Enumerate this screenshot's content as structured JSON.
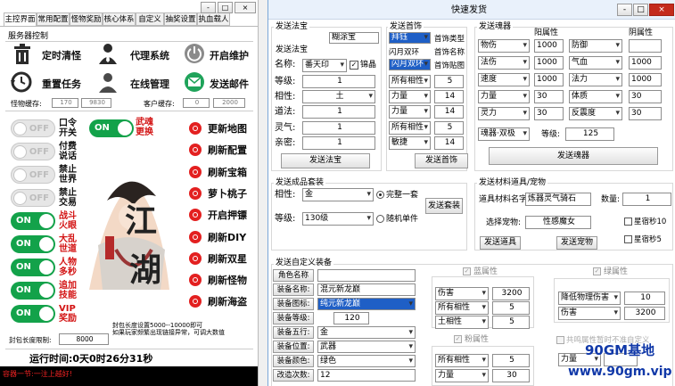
{
  "left": {
    "title": "",
    "tabs": [
      "主控界面",
      "常用配置",
      "怪物奖励",
      "核心体系",
      "自定义",
      "抽奖设置",
      "执血载人"
    ],
    "server_section": "服务器控制",
    "server_buttons": [
      {
        "label": "定时清怪",
        "icon": "trash-icon"
      },
      {
        "label": "代理系统",
        "icon": "agent-icon"
      },
      {
        "label": "开启维护",
        "icon": "power-icon"
      },
      {
        "label": "重置任务",
        "icon": "refresh-clock-icon"
      },
      {
        "label": "在线管理",
        "icon": "users-icon"
      },
      {
        "label": "发送邮件",
        "icon": "mail-icon"
      }
    ],
    "monster_cache_label": "怪物缓存:",
    "monster_cache_a": "170",
    "monster_cache_b": "9830",
    "client_cache_label": "客户缓存:",
    "client_cache_a": "0",
    "client_cache_b": "2000",
    "toggles": [
      {
        "state": "OFF",
        "label": "口令开关",
        "red": false
      },
      {
        "state": "OFF",
        "label": "付费说话",
        "red": false
      },
      {
        "state": "OFF",
        "label": "禁止世界",
        "red": false
      },
      {
        "state": "OFF",
        "label": "禁止交易",
        "red": false
      },
      {
        "state": "ON",
        "label": "战斗火眼",
        "red": true
      },
      {
        "state": "ON",
        "label": "大乱世道",
        "red": true
      },
      {
        "state": "ON",
        "label": "人物多秒",
        "red": true
      },
      {
        "state": "ON",
        "label": "追加技能",
        "red": true
      },
      {
        "state": "ON",
        "label": "VIP奖励",
        "red": true
      }
    ],
    "toggle_top": {
      "state": "ON",
      "label": "武魂更换"
    },
    "right_links": [
      "更新地图",
      "刷新配置",
      "刷新宝箱",
      "萝卜桃子",
      "开启押镖",
      "刷新DIY",
      "刷新双星",
      "刷新怪物",
      "刷新海盗"
    ],
    "note1": "封包长度设置5000--10000即可",
    "note2": "如果玩家频繁出现链接异常，可调大数值",
    "packet_label": "封包长度限制:",
    "packet_value": "8000",
    "runtime": "运行时间:0天0时26分31秒",
    "status_red": "容器一节:一注上越好!"
  },
  "right": {
    "title": "快速发货",
    "win_buttons": [
      "-",
      "□",
      "×"
    ],
    "left_win_buttons": [
      "-",
      "□",
      "×"
    ],
    "fabao": {
      "group": "发送法宝",
      "name_label": "名称:",
      "name_value": "番天印",
      "checkbox_label": "锦晶",
      "checkbox_checked": true,
      "rows": [
        {
          "label": "等级:",
          "value": "1"
        },
        {
          "label": "相性:",
          "value": "土"
        },
        {
          "label": "道法:",
          "value": "1"
        },
        {
          "label": "灵气:",
          "value": "1"
        },
        {
          "label": "亲密:",
          "value": "1"
        }
      ],
      "top_label": "发送法宝",
      "top_value": "糊涂宝",
      "button": "发送法宝"
    },
    "shoushi": {
      "group": "发送首饰",
      "top_value": "拜钰",
      "type_label": "首饰类型",
      "alias_label": "首饰名称",
      "name_value": "闪月双环",
      "sticker_label": "首饰贴图",
      "rows": [
        {
          "a": "所有相性",
          "b": "5"
        },
        {
          "a": "力量",
          "b": "14"
        },
        {
          "a": "力量",
          "b": "14"
        },
        {
          "a": "所有相性",
          "b": "5"
        },
        {
          "a": "敏捷",
          "b": "14"
        }
      ],
      "button": "发送首饰"
    },
    "soul": {
      "group": "发送魂器",
      "col1": "阳属性",
      "col2": "阴属性",
      "rows": [
        {
          "a": "物伤",
          "av": "1000",
          "b": "防御",
          "bv": ""
        },
        {
          "a": "法伤",
          "av": "1000",
          "b": "气血",
          "bv": "1000"
        },
        {
          "a": "速度",
          "av": "1000",
          "b": "法力",
          "bv": "1000"
        },
        {
          "a": "力量",
          "av": "30",
          "b": "体质",
          "bv": "30"
        },
        {
          "a": "灵力",
          "av": "30",
          "b": "反震度",
          "bv": "30"
        }
      ],
      "weapon_value": "魂器·双极",
      "level_label": "等级:",
      "level_value": "125",
      "button": "发送魂器"
    },
    "equip": {
      "group": "发送成品套装",
      "xiang_label": "相性:",
      "xiang_value": "金",
      "radio1": "完整一套",
      "radio2": "随机单件",
      "level_label": "等级:",
      "level_value": "130级",
      "button": "发送套装"
    },
    "item": {
      "group": "发送材料道具/宠物",
      "item_label": "道具材料名字:",
      "item_value": "炼器灵气骑石",
      "count_label": "数量:",
      "count_value": "1",
      "pet_label": "选择宠物:",
      "pet_value": "性感魔女",
      "cb1": "星宿秒10",
      "cb2": "星宿秒5",
      "btn1": "发送道具",
      "btn2": "发送宠物"
    },
    "custom": {
      "group": "发送自定义装备",
      "fields": [
        {
          "label": "角色名称",
          "value": ""
        },
        {
          "label": "装备名称:",
          "value": "混元新龙巅"
        },
        {
          "label": "装备图标:",
          "value": "纯元新龙巅"
        },
        {
          "label": "装备等级:",
          "value": "120"
        },
        {
          "label": "装备五行:",
          "value": "金"
        },
        {
          "label": "装备位置:",
          "value": "武器"
        },
        {
          "label": "装备颜色:",
          "value": "绿色"
        },
        {
          "label": "改造次数:",
          "value": "12"
        }
      ],
      "blue_group": "蓝属性",
      "blue_rows": [
        {
          "a": "伤害",
          "b": "3200"
        },
        {
          "a": "所有相性",
          "b": "5"
        },
        {
          "a": "土相性",
          "b": "5"
        }
      ],
      "pink_group": "粉属性",
      "pink_rows": [
        {
          "a": "所有相性",
          "b": "5"
        },
        {
          "a": "力量",
          "b": "30"
        }
      ],
      "green_group": "绿属性",
      "green_rows": [
        {
          "a": "降低物理伤害",
          "b": "10"
        },
        {
          "a": "伤害",
          "b": "3200"
        }
      ],
      "yellow_cb": "共鸣属性暂时不准自定义",
      "yellow_row": {
        "a": "力量",
        "b": ""
      }
    },
    "watermark1": "90GM基地",
    "watermark2": "www.90gm.vip"
  },
  "colors": {
    "blue_title": "#ffffff",
    "accent_red": "#d31414",
    "switch_green": "#13a24a",
    "watermark": "#1038a8"
  }
}
